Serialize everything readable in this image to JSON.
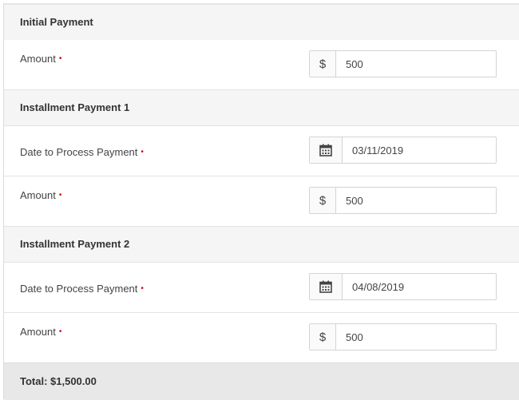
{
  "initial": {
    "title": "Initial Payment",
    "amount_label": "Amount",
    "currency": "$",
    "amount": "500"
  },
  "installment1": {
    "title": "Installment Payment 1",
    "date_label": "Date to Process Payment",
    "date": "03/11/2019",
    "amount_label": "Amount",
    "currency": "$",
    "amount": "500"
  },
  "installment2": {
    "title": "Installment Payment 2",
    "date_label": "Date to Process Payment",
    "date": "04/08/2019",
    "amount_label": "Amount",
    "currency": "$",
    "amount": "500"
  },
  "required_marker": "•",
  "total": "Total: $1,500.00",
  "icons": {
    "calendar": "calendar-icon",
    "currency": "dollar-icon"
  },
  "colors": {
    "required": "#d0021b",
    "header_bg": "#f5f5f5",
    "total_bg": "#e8e8e8"
  }
}
